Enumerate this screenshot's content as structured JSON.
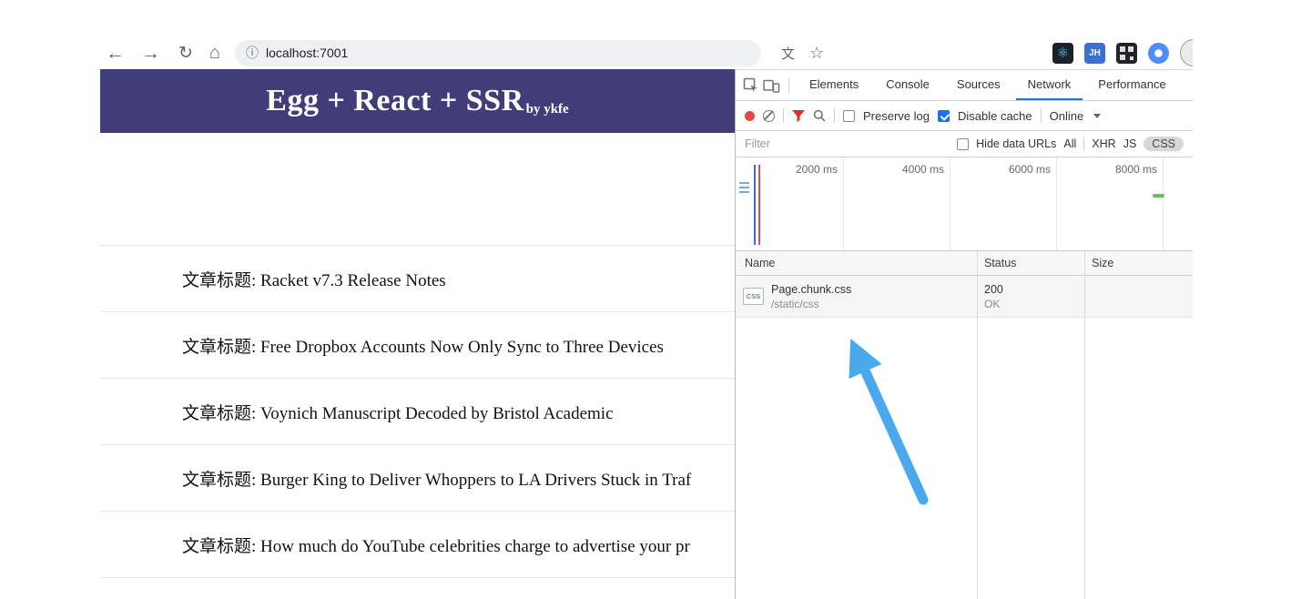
{
  "browser": {
    "url": "localhost:7001",
    "icons": {
      "back": "←",
      "forward": "→",
      "reload": "↻",
      "home": "⌂",
      "info": "ⓘ",
      "translate": "文",
      "star": "☆",
      "react": "⚛",
      "jh": "JH"
    }
  },
  "page": {
    "header": {
      "title": "Egg + React + SSR",
      "byline": "by ykfe"
    },
    "articles": [
      {
        "title": "文章标题: Racket v7.3 Release Notes"
      },
      {
        "title": "文章标题: Free Dropbox Accounts Now Only Sync to Three Devices"
      },
      {
        "title": "文章标题: Voynich Manuscript Decoded by Bristol Academic"
      },
      {
        "title": "文章标题: Burger King to Deliver Whoppers to LA Drivers Stuck in Traf"
      },
      {
        "title": "文章标题: How much do YouTube celebrities charge to advertise your pr"
      }
    ]
  },
  "devtools": {
    "tabs": {
      "elements": "Elements",
      "console": "Console",
      "sources": "Sources",
      "network": "Network",
      "performance": "Performance"
    },
    "network_toolbar": {
      "preserve_log": "Preserve log",
      "disable_cache": "Disable cache",
      "throttling": "Online"
    },
    "filter_bar": {
      "placeholder": "Filter",
      "hide_data_urls": "Hide data URLs",
      "all": "All",
      "xhr": "XHR",
      "js": "JS",
      "css": "CSS"
    },
    "timeline": {
      "ticks": [
        "2000 ms",
        "4000 ms",
        "6000 ms",
        "8000 ms"
      ]
    },
    "table": {
      "headers": {
        "name": "Name",
        "status": "Status",
        "size": "Size"
      },
      "rows": [
        {
          "file_type": "CSS",
          "name": "Page.chunk.css",
          "path": "/static/css",
          "status": "200",
          "status_text": "OK",
          "size": ""
        }
      ]
    }
  },
  "colors": {
    "header_bg": "#413d78",
    "accent_blue": "#1a73e8",
    "record_red": "#e14b42",
    "filter_red": "#d93025",
    "arrow_blue": "#4aa9ec"
  }
}
